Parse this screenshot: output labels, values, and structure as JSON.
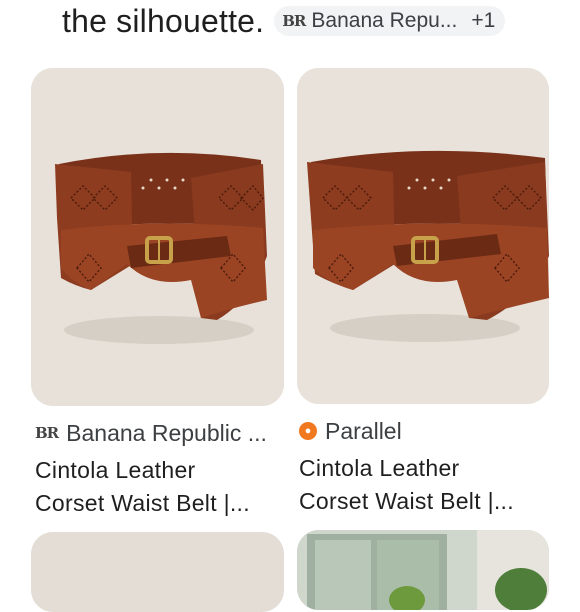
{
  "header": {
    "text": "the silhouette.",
    "chip": {
      "logo": "BR",
      "label": "Banana Repu...",
      "extra": "+1"
    }
  },
  "results": [
    {
      "source": {
        "logo": "BR",
        "name": "Banana Republic ..."
      },
      "title": "Cintola Leather\nCorset Waist Belt |..."
    },
    {
      "source": {
        "logo": "Parallel logo",
        "name": "Parallel"
      },
      "title": "Cintola Leather\nCorset Waist Belt |..."
    }
  ],
  "colors": {
    "card_bg": "#e6e0d8",
    "leather": "#8b3a1e",
    "leather_dark": "#5e2410",
    "buckle": "#c8a24a",
    "parallel": "#f0781f"
  }
}
